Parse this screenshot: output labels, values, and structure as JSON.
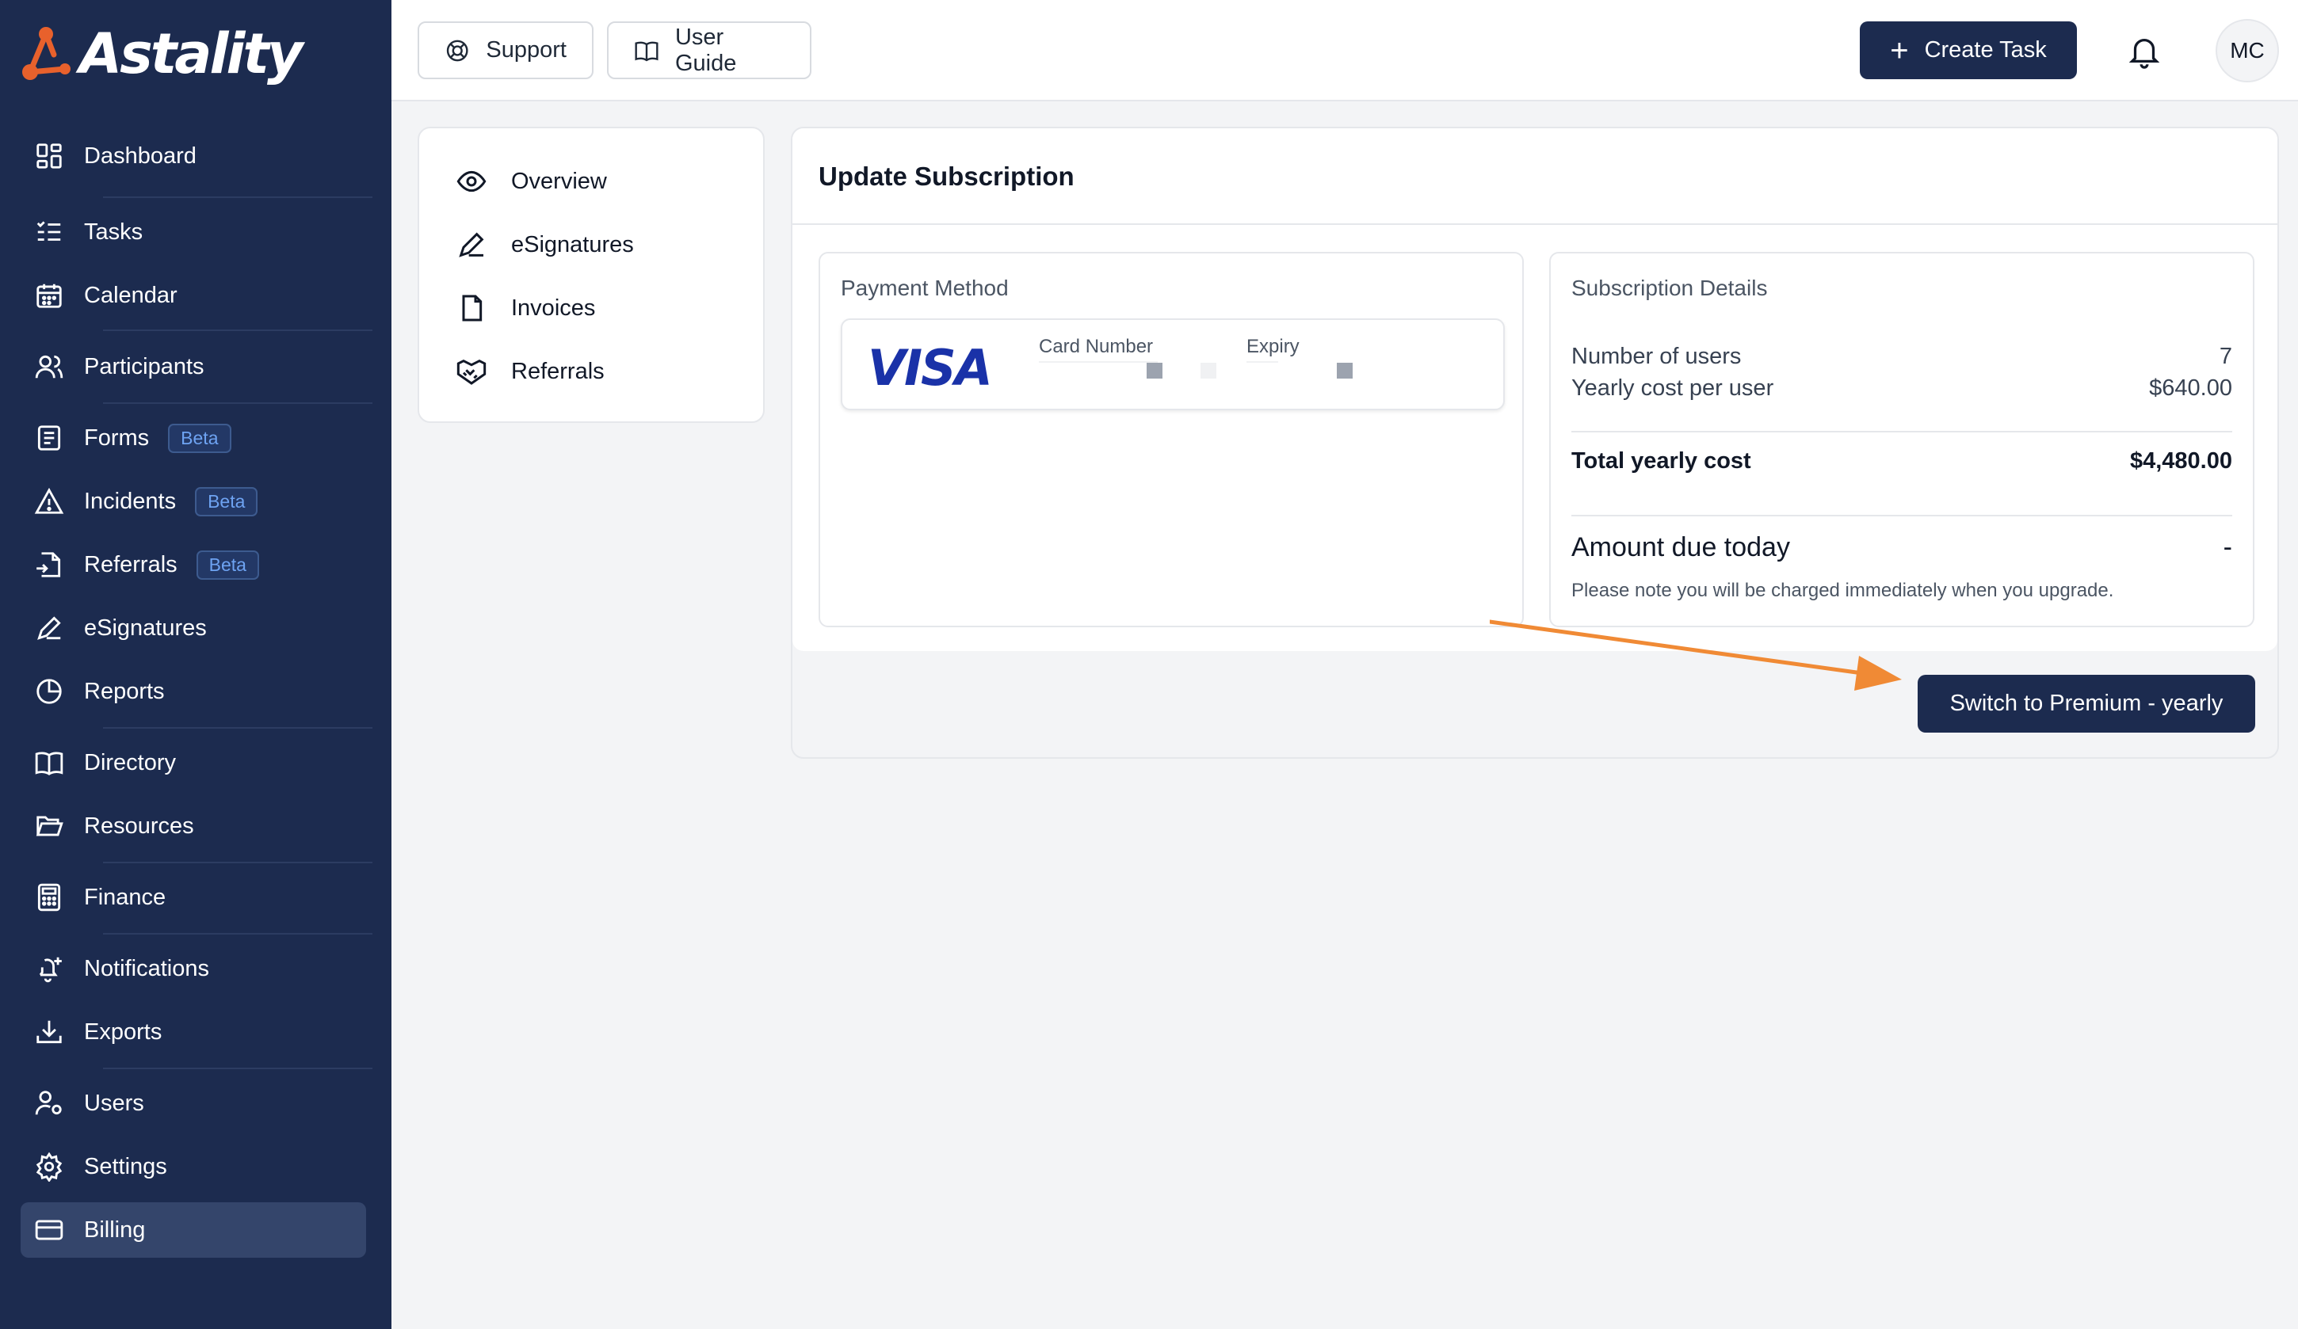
{
  "brand": {
    "name": "Astality"
  },
  "sidebar": {
    "items": [
      {
        "label": "Dashboard",
        "icon": "dashboard-icon"
      },
      {
        "label": "Tasks",
        "icon": "tasks-icon"
      },
      {
        "label": "Calendar",
        "icon": "calendar-icon"
      },
      {
        "label": "Participants",
        "icon": "participants-icon"
      },
      {
        "label": "Forms",
        "icon": "forms-icon",
        "badge": "Beta"
      },
      {
        "label": "Incidents",
        "icon": "warning-icon",
        "badge": "Beta"
      },
      {
        "label": "Referrals",
        "icon": "referral-file-icon",
        "badge": "Beta"
      },
      {
        "label": "eSignatures",
        "icon": "pen-icon"
      },
      {
        "label": "Reports",
        "icon": "pie-chart-icon"
      },
      {
        "label": "Directory",
        "icon": "book-icon"
      },
      {
        "label": "Resources",
        "icon": "folder-open-icon"
      },
      {
        "label": "Finance",
        "icon": "calculator-icon"
      },
      {
        "label": "Notifications",
        "icon": "bell-plus-icon"
      },
      {
        "label": "Exports",
        "icon": "download-icon"
      },
      {
        "label": "Users",
        "icon": "user-cog-icon"
      },
      {
        "label": "Settings",
        "icon": "gear-icon"
      },
      {
        "label": "Billing",
        "icon": "credit-card-icon",
        "active": true
      }
    ]
  },
  "header": {
    "support_label": "Support",
    "user_guide_label": "User Guide",
    "create_task_label": "Create Task",
    "avatar_initials": "MC"
  },
  "billing_nav": {
    "items": [
      {
        "label": "Overview",
        "icon": "eye-icon"
      },
      {
        "label": "eSignatures",
        "icon": "pen-icon"
      },
      {
        "label": "Invoices",
        "icon": "document-icon"
      },
      {
        "label": "Referrals",
        "icon": "handshake-icon"
      }
    ]
  },
  "subscription": {
    "title": "Update Subscription",
    "payment": {
      "title": "Payment Method",
      "card_brand": "VISA",
      "card_number_label": "Card Number",
      "expiry_label": "Expiry"
    },
    "details": {
      "title": "Subscription Details",
      "users_label": "Number of users",
      "users_value": "7",
      "per_user_label": "Yearly cost per user",
      "per_user_value": "$640.00",
      "total_label": "Total yearly cost",
      "total_value": "$4,480.00",
      "due_label": "Amount due today",
      "due_value": "-",
      "note": "Please note you will be charged immediately when you upgrade."
    },
    "action_label": "Switch to Premium - yearly"
  },
  "colors": {
    "sidebar_bg": "#1c2b4f",
    "primary": "#1c2b4f",
    "accent": "#f08a35",
    "badge_text": "#6ea3f2",
    "visa_blue": "#1a32a8"
  }
}
